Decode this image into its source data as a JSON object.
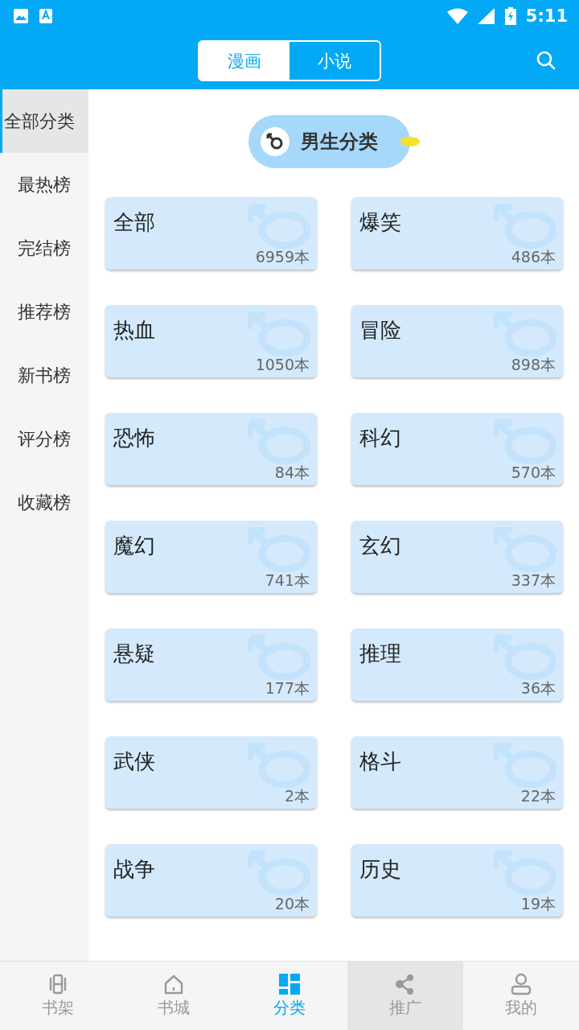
{
  "status_bar": {
    "time": "5:11"
  },
  "header": {
    "tabs": [
      {
        "label": "漫画",
        "selected": true
      },
      {
        "label": "小说",
        "selected": false
      }
    ]
  },
  "sidebar": {
    "items": [
      {
        "label": "全部分类",
        "selected": true
      },
      {
        "label": "最热榜",
        "selected": false
      },
      {
        "label": "完结榜",
        "selected": false
      },
      {
        "label": "推荐榜",
        "selected": false
      },
      {
        "label": "新书榜",
        "selected": false
      },
      {
        "label": "评分榜",
        "selected": false
      },
      {
        "label": "收藏榜",
        "selected": false
      }
    ]
  },
  "section": {
    "title": "男生分类"
  },
  "categories": [
    {
      "name": "全部",
      "count": "6959本"
    },
    {
      "name": "爆笑",
      "count": "486本"
    },
    {
      "name": "热血",
      "count": "1050本"
    },
    {
      "name": "冒险",
      "count": "898本"
    },
    {
      "name": "恐怖",
      "count": "84本"
    },
    {
      "name": "科幻",
      "count": "570本"
    },
    {
      "name": "魔幻",
      "count": "741本"
    },
    {
      "name": "玄幻",
      "count": "337本"
    },
    {
      "name": "悬疑",
      "count": "177本"
    },
    {
      "name": "推理",
      "count": "36本"
    },
    {
      "name": "武侠",
      "count": "2本"
    },
    {
      "name": "格斗",
      "count": "22本"
    },
    {
      "name": "战争",
      "count": "20本"
    },
    {
      "name": "历史",
      "count": "19本"
    }
  ],
  "bottom_nav": [
    {
      "label": "书架",
      "selected": false,
      "pressed": false
    },
    {
      "label": "书城",
      "selected": false,
      "pressed": false
    },
    {
      "label": "分类",
      "selected": true,
      "pressed": false
    },
    {
      "label": "推广",
      "selected": false,
      "pressed": true
    },
    {
      "label": "我的",
      "selected": false,
      "pressed": false
    }
  ]
}
